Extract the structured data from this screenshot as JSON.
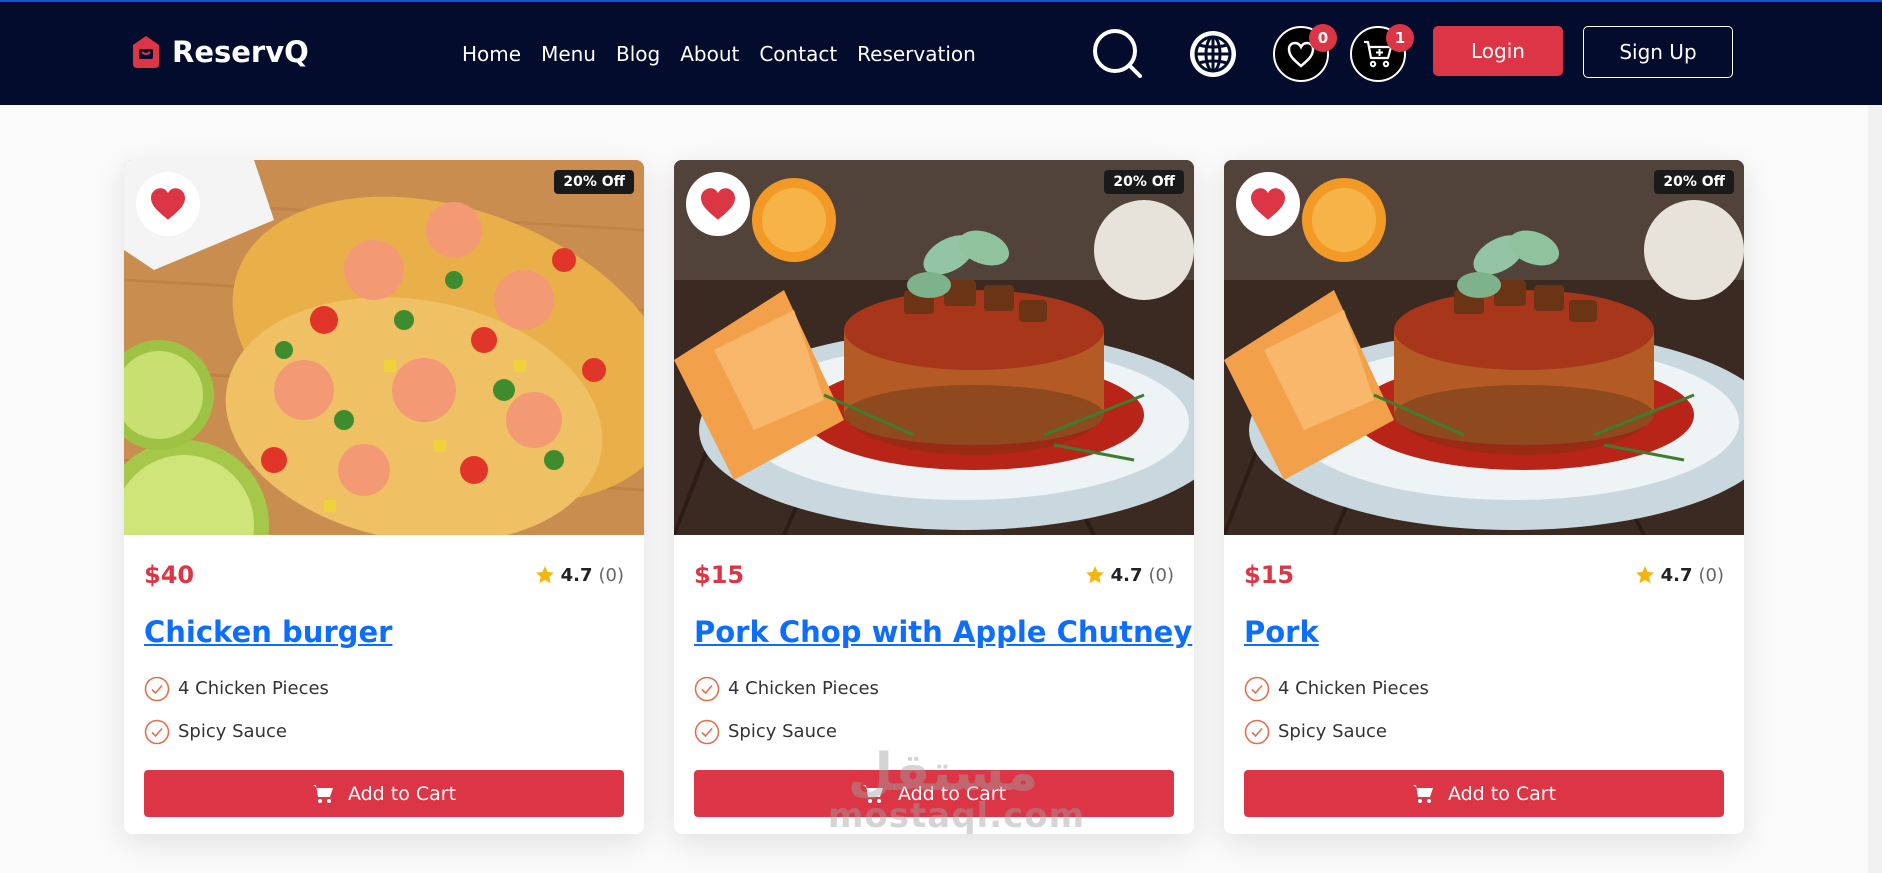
{
  "brand": {
    "name": "ReservQ",
    "color": "#dc3545"
  },
  "nav": {
    "links": [
      "Home",
      "Menu",
      "Blog",
      "About",
      "Contact",
      "Reservation"
    ]
  },
  "header_icons": {
    "search": "search-icon",
    "language": "globe-icon",
    "wishlist": {
      "icon": "heart-icon",
      "count": "0"
    },
    "cart": {
      "icon": "cart-icon",
      "count": "1"
    }
  },
  "auth": {
    "login": "Login",
    "signup": "Sign Up"
  },
  "colors": {
    "navbar": "#030c2d",
    "accent": "#dc3545",
    "link": "#0d6efd",
    "star": "#f5b50a"
  },
  "products": [
    {
      "discount": "20% Off",
      "price": "$40",
      "rating": "4.7",
      "rating_count": "(0)",
      "title": "Chicken burger",
      "features": [
        "4 Chicken Pieces",
        "Spicy Sauce"
      ],
      "cta": "Add to Cart",
      "image": "shrimp-taco-photo"
    },
    {
      "discount": "20% Off",
      "price": "$15",
      "rating": "4.7",
      "rating_count": "(0)",
      "title": "Pork Chop with Apple Chutney",
      "features": [
        "4 Chicken Pieces",
        "Spicy Sauce"
      ],
      "cta": "Add to Cart",
      "image": "pork-dish-photo"
    },
    {
      "discount": "20% Off",
      "price": "$15",
      "rating": "4.7",
      "rating_count": "(0)",
      "title": "Pork",
      "features": [
        "4 Chicken Pieces",
        "Spicy Sauce"
      ],
      "cta": "Add to Cart",
      "image": "pork-dish-photo"
    }
  ],
  "watermark": {
    "arabic": "مستقل",
    "latin": "mostaql.com"
  }
}
